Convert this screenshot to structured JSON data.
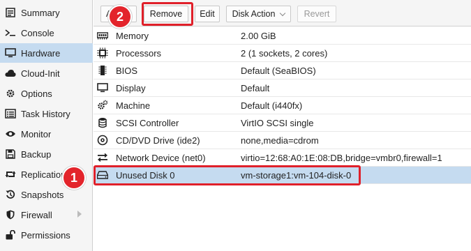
{
  "sidebar": {
    "items": [
      {
        "label": "Summary",
        "icon": "summary-icon"
      },
      {
        "label": "Console",
        "icon": "console-icon"
      },
      {
        "label": "Hardware",
        "icon": "monitor-icon"
      },
      {
        "label": "Cloud-Init",
        "icon": "cloud-icon"
      },
      {
        "label": "Options",
        "icon": "gear-icon"
      },
      {
        "label": "Task History",
        "icon": "list-icon"
      },
      {
        "label": "Monitor",
        "icon": "eye-icon"
      },
      {
        "label": "Backup",
        "icon": "floppy-icon"
      },
      {
        "label": "Replication",
        "icon": "retweet-icon"
      },
      {
        "label": "Snapshots",
        "icon": "history-icon"
      },
      {
        "label": "Firewall",
        "icon": "shield-icon"
      },
      {
        "label": "Permissions",
        "icon": "unlock-icon"
      }
    ],
    "active": "Hardware"
  },
  "toolbar": {
    "add_label": "Add",
    "remove_label": "Remove",
    "edit_label": "Edit",
    "disk_action_label": "Disk Action",
    "revert_label": "Revert"
  },
  "hardware": {
    "rows": [
      {
        "name": "Memory",
        "value": "2.00 GiB",
        "icon": "memory-icon"
      },
      {
        "name": "Processors",
        "value": "2 (1 sockets, 2 cores)",
        "icon": "cpu-icon"
      },
      {
        "name": "BIOS",
        "value": "Default (SeaBIOS)",
        "icon": "chip-icon"
      },
      {
        "name": "Display",
        "value": "Default",
        "icon": "desktop-icon"
      },
      {
        "name": "Machine",
        "value": "Default (i440fx)",
        "icon": "cogs-icon"
      },
      {
        "name": "SCSI Controller",
        "value": "VirtIO SCSI single",
        "icon": "database-icon"
      },
      {
        "name": "CD/DVD Drive (ide2)",
        "value": "none,media=cdrom",
        "icon": "cdrom-icon"
      },
      {
        "name": "Network Device (net0)",
        "value": "virtio=12:68:A0:1E:08:DB,bridge=vmbr0,firewall=1",
        "icon": "exchange-icon"
      },
      {
        "name": "Unused Disk 0",
        "value": "vm-storage1:vm-104-disk-0",
        "icon": "hdd-icon"
      }
    ],
    "selected": "Unused Disk 0"
  },
  "annotations": {
    "step1": "1",
    "step2": "2",
    "color": "#e0202a"
  }
}
